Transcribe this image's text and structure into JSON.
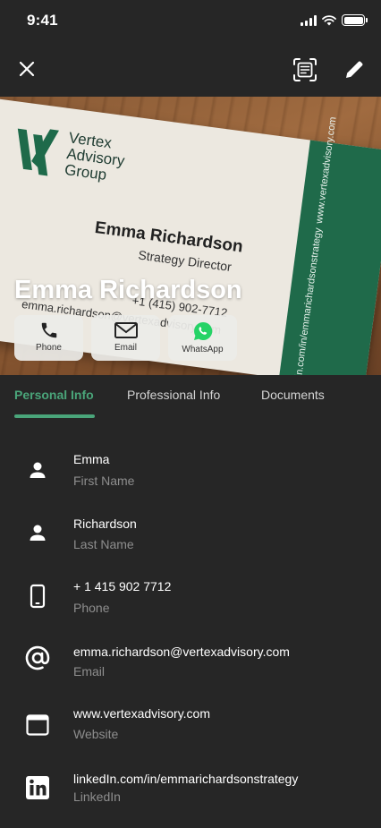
{
  "status_bar": {
    "time": "9:41"
  },
  "toolbar": {
    "close_icon": "close-icon",
    "scan_icon": "scan-card-icon",
    "edit_icon": "pencil-icon"
  },
  "card": {
    "company_lines": [
      "Vertex",
      "Advisory",
      "Group"
    ],
    "name": "Emma Richardson",
    "title": "Strategy Director",
    "phone": "+1 (415) 902-7712",
    "email": "emma.richardson@vertexadvisory.com",
    "strip_lines": [
      "www.vertexadvisory.com",
      "linkedin.com/in/emmarichardsonstrategy"
    ],
    "colors": {
      "brand_green": "#1f6a4a",
      "paper": "#ece8e0"
    }
  },
  "hero": {
    "contact_name": "Emma Richardson",
    "actions": [
      {
        "label": "Phone",
        "icon": "phone-icon"
      },
      {
        "label": "Email",
        "icon": "envelope-icon"
      },
      {
        "label": "WhatsApp",
        "icon": "whatsapp-icon"
      }
    ]
  },
  "tabs": [
    {
      "label": "Personal Info",
      "active": true
    },
    {
      "label": "Professional Info",
      "active": false
    },
    {
      "label": "Documents",
      "active": false
    }
  ],
  "accent_color": "#4aa57a",
  "fields": [
    {
      "value": "Emma",
      "label": "First Name",
      "icon": "person-icon"
    },
    {
      "value": "Richardson",
      "label": "Last Name",
      "icon": "person-icon"
    },
    {
      "value": "+ 1 415 902 7712",
      "label": "Phone",
      "icon": "mobile-phone-icon"
    },
    {
      "value": "emma.richardson@vertexadvisory.com",
      "label": "Email",
      "icon": "at-sign-icon"
    },
    {
      "value": "www.vertexadvisory.com",
      "label": "Website",
      "icon": "browser-window-icon"
    },
    {
      "value": "linkedIn.com/in/emmarichardsonstrategy",
      "label": "LinkedIn",
      "icon": "linkedin-icon"
    }
  ]
}
